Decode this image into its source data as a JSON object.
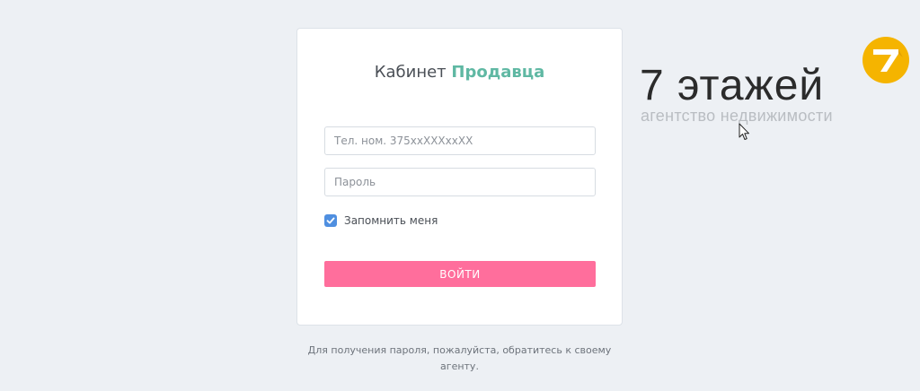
{
  "login": {
    "title_prefix": "Кабинет",
    "title_accent": "Продавца",
    "phone_placeholder": "Тел. ном. 375xxXXXxxXX",
    "password_placeholder": "Пароль",
    "remember_label": "Запомнить меня",
    "remember_checked": true,
    "submit_label": "ВОЙТИ"
  },
  "hint": {
    "text": "Для получения пароля, пожалуйста, обратитесь к своему агенту."
  },
  "logo": {
    "name": "7 этажей",
    "tagline": "агентство недвижимости",
    "badge_icon": "seven-badge-icon"
  },
  "colors": {
    "accent_green": "#5fb8a3",
    "button_pink": "#ff6e9c",
    "checkbox_blue": "#4f8fe0",
    "logo_yellow": "#f5b400"
  }
}
